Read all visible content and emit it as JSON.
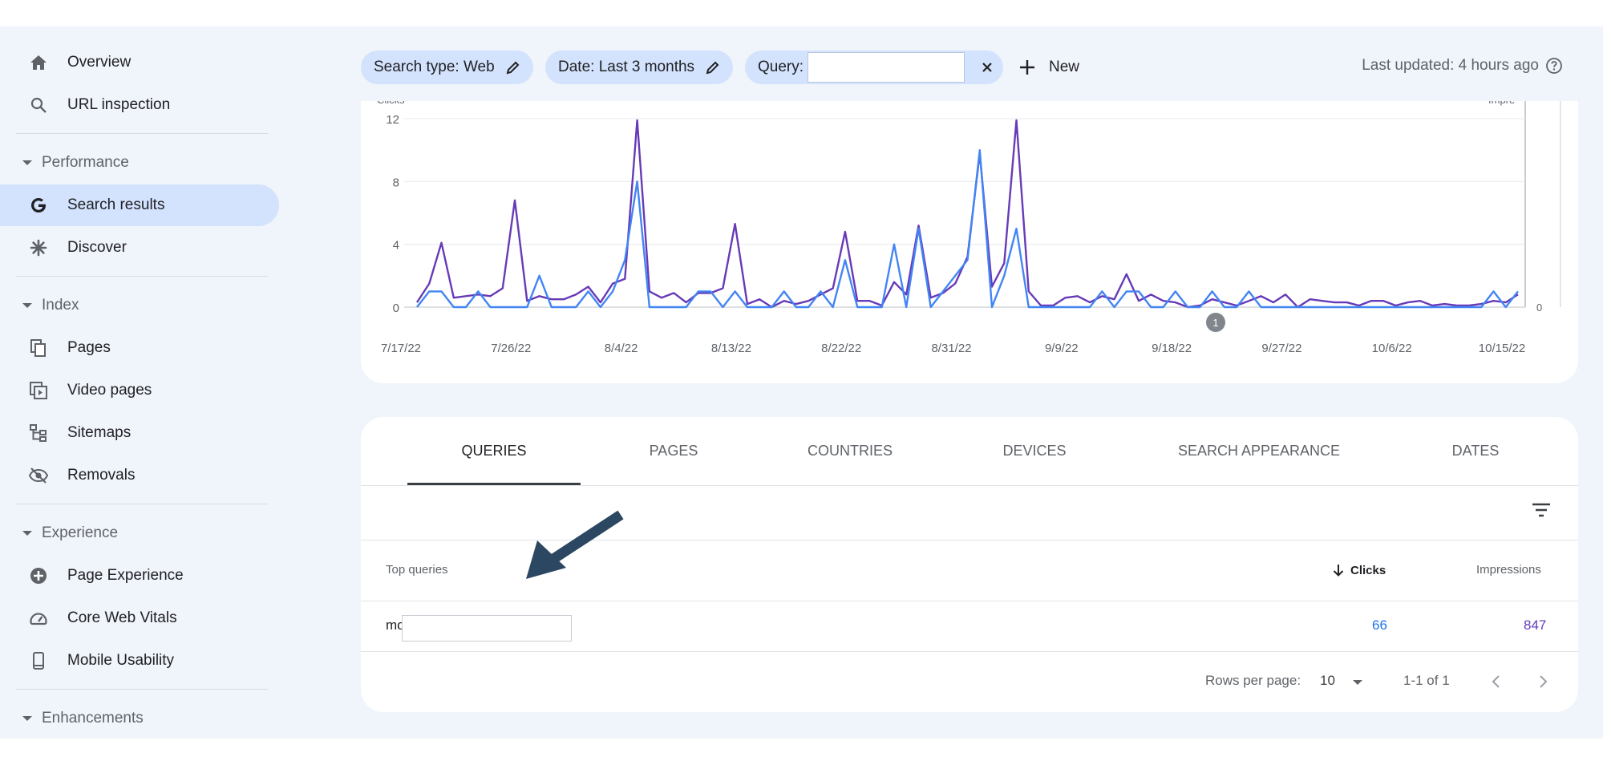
{
  "sidebar": {
    "items": [
      {
        "label": "Overview",
        "icon": "home-icon"
      },
      {
        "label": "URL inspection",
        "icon": "search-icon"
      },
      {
        "label": "Search results",
        "icon": "google-g-icon"
      },
      {
        "label": "Discover",
        "icon": "asterisk-icon"
      },
      {
        "label": "Pages",
        "icon": "pages-icon"
      },
      {
        "label": "Video pages",
        "icon": "video-pages-icon"
      },
      {
        "label": "Sitemaps",
        "icon": "sitemap-icon"
      },
      {
        "label": "Removals",
        "icon": "eye-off-icon"
      },
      {
        "label": "Page Experience",
        "icon": "plus-circle-icon"
      },
      {
        "label": "Core Web Vitals",
        "icon": "gauge-icon"
      },
      {
        "label": "Mobile Usability",
        "icon": "phone-icon"
      }
    ],
    "sections": [
      "Performance",
      "Index",
      "Experience",
      "Enhancements"
    ]
  },
  "filters": {
    "search_type": "Search type: Web",
    "date": "Date: Last 3 months",
    "query_label": "Query:",
    "new_label": "New",
    "last_updated": "Last updated: 4 hours ago"
  },
  "chart_data": {
    "type": "line",
    "ylabel_left": "Clicks",
    "ylabel_right": "Impre",
    "yticks": [
      "12",
      "8",
      "4",
      "0"
    ],
    "right_ytick": "0",
    "ylim": [
      0,
      12
    ],
    "x_tick_labels": [
      "7/17/22",
      "7/26/22",
      "8/4/22",
      "8/13/22",
      "8/22/22",
      "8/31/22",
      "9/9/22",
      "9/18/22",
      "9/27/22",
      "10/6/22",
      "10/15/22"
    ],
    "annotation_badge": "1",
    "series": [
      {
        "color": "#673ab7",
        "values": [
          0.3,
          1.5,
          4.1,
          0.6,
          0.7,
          0.8,
          0.7,
          1.2,
          6.8,
          0.4,
          0.7,
          0.5,
          0.5,
          0.8,
          1.3,
          0.3,
          1.5,
          1.8,
          11.9,
          1.0,
          0.6,
          0.9,
          0.3,
          0.9,
          0.9,
          1.2,
          5.3,
          0.2,
          0.5,
          0.0,
          0.4,
          0.2,
          0.4,
          0.8,
          1.2,
          4.8,
          0.4,
          0.4,
          0.1,
          1.6,
          0.8,
          5.2,
          0.6,
          0.9,
          1.5,
          3.2,
          9.8,
          1.3,
          2.8,
          11.9,
          1.0,
          0.1,
          0.1,
          0.6,
          0.7,
          0.3,
          0.7,
          0.5,
          2.1,
          0.4,
          0.8,
          0.4,
          0.3,
          0.0,
          0.1,
          0.5,
          0.3,
          0.1,
          0.4,
          0.7,
          0.3,
          0.8,
          0.0,
          0.5,
          0.4,
          0.3,
          0.3,
          0.1,
          0.4,
          0.4,
          0.1,
          0.3,
          0.4,
          0.1,
          0.2,
          0.1,
          0.1,
          0.2,
          0.4,
          0.3,
          0.8
        ]
      },
      {
        "color": "#4285f4",
        "values": [
          0.0,
          1.0,
          1.0,
          0.0,
          0.0,
          1.0,
          0.0,
          0.0,
          0.0,
          0.0,
          2.0,
          0.0,
          0.0,
          0.0,
          1.0,
          0.0,
          1.0,
          3.0,
          8.0,
          0.0,
          0.0,
          0.0,
          0.0,
          1.0,
          1.0,
          0.0,
          1.0,
          0.0,
          0.0,
          0.0,
          1.0,
          0.0,
          0.0,
          1.0,
          0.0,
          3.0,
          0.0,
          0.0,
          0.0,
          4.0,
          0.0,
          5.0,
          0.0,
          1.0,
          2.0,
          3.0,
          10.0,
          0.0,
          2.0,
          5.0,
          0.0,
          0.0,
          0.0,
          0.0,
          0.0,
          0.0,
          1.0,
          0.0,
          1.0,
          1.0,
          0.0,
          0.0,
          1.0,
          0.0,
          0.0,
          1.0,
          0.0,
          0.0,
          1.0,
          0.0,
          0.0,
          0.0,
          0.0,
          0.0,
          0.0,
          0.0,
          0.0,
          0.0,
          0.0,
          0.0,
          0.0,
          0.0,
          0.0,
          0.0,
          0.0,
          0.0,
          0.0,
          0.0,
          1.0,
          0.0,
          1.0
        ]
      }
    ]
  },
  "table": {
    "tabs": [
      "QUERIES",
      "PAGES",
      "COUNTRIES",
      "DEVICES",
      "SEARCH APPEARANCE",
      "DATES"
    ],
    "headers": {
      "query": "Top queries",
      "clicks": "Clicks",
      "impressions": "Impressions"
    },
    "rows": [
      {
        "query_prefix": "mo",
        "clicks": "66",
        "impressions": "847"
      }
    ],
    "rows_per_page_label": "Rows per page:",
    "rows_per_page_value": "10",
    "range": "1-1 of 1"
  },
  "colors": {
    "clicks": "#1a73e8",
    "impressions": "#673ab7",
    "accent": "#d3e2fd",
    "annotation_arrow": "#2c4762"
  }
}
